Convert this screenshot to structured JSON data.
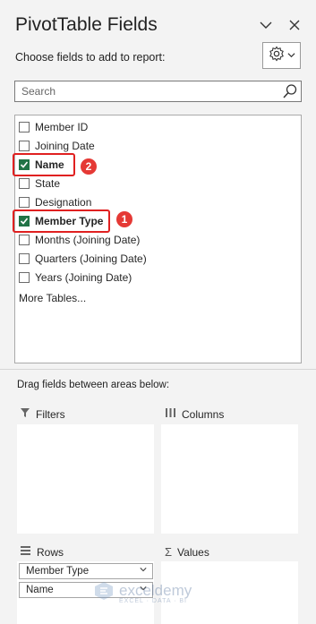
{
  "header": {
    "title": "PivotTable Fields",
    "subtitle": "Choose fields to add to report:"
  },
  "search": {
    "placeholder": "Search"
  },
  "fields": [
    {
      "label": "Member ID",
      "checked": false
    },
    {
      "label": "Joining Date",
      "checked": false
    },
    {
      "label": "Name",
      "checked": true
    },
    {
      "label": "State",
      "checked": false
    },
    {
      "label": "Designation",
      "checked": false
    },
    {
      "label": "Member Type",
      "checked": true
    },
    {
      "label": "Months (Joining Date)",
      "checked": false
    },
    {
      "label": "Quarters (Joining Date)",
      "checked": false
    },
    {
      "label": "Years (Joining Date)",
      "checked": false
    }
  ],
  "more_tables": "More Tables...",
  "annotations": {
    "badge_name": "2",
    "badge_member_type": "1"
  },
  "drag_hint": "Drag fields between areas below:",
  "areas": {
    "filters": {
      "label": "Filters"
    },
    "columns": {
      "label": "Columns"
    },
    "rows": {
      "label": "Rows",
      "items": [
        "Member Type",
        "Name"
      ]
    },
    "values": {
      "label": "Values"
    }
  },
  "watermark": {
    "brand": "exceldemy",
    "tagline": "EXCEL · DATA · BI"
  },
  "colors": {
    "check_green": "#217346",
    "highlight_red": "#e02020",
    "badge_red": "#e53935"
  }
}
